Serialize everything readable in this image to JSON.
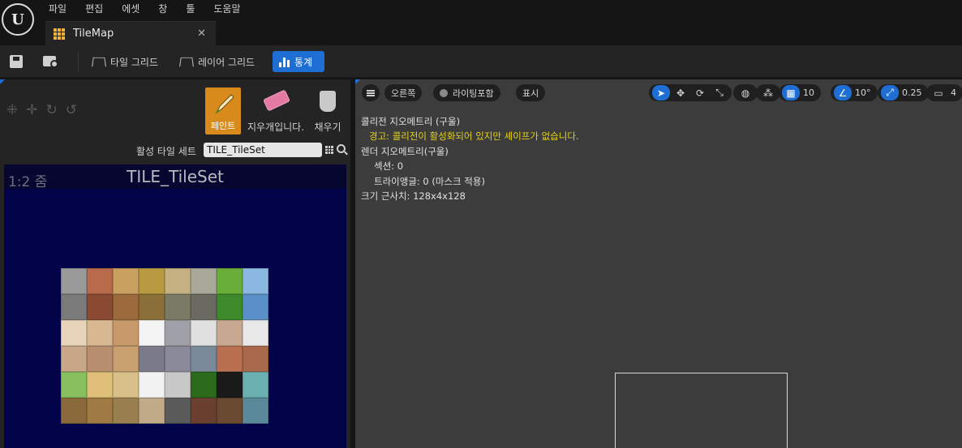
{
  "app": {
    "logo_text": "U",
    "menu": [
      "파일",
      "편집",
      "에셋",
      "창",
      "툴",
      "도움말"
    ]
  },
  "tab": {
    "title": "TileMap",
    "close": "✕"
  },
  "toolbar": {
    "tile_grid": "타일 그리드",
    "layer_grid": "레이어 그리드",
    "stats": "통계"
  },
  "tools": {
    "paint": "페인트",
    "erase": "지우개입니다.",
    "fill": "채우기"
  },
  "tileset": {
    "active_label": "활성 타일 세트",
    "active_value": "TILE_TileSet",
    "zoom": "1:2 줌",
    "title": "TILE_TileSet"
  },
  "viewport": {
    "perspective": "오른쪽",
    "lighting": "라이팅포함",
    "show": "표시",
    "grid_snap": "10",
    "rot_snap": "10°",
    "scale_snap": "0.25",
    "camera_speed": "4"
  },
  "stats": {
    "collision_geometry": "콜리전 지오메트리 (구울)",
    "warning": "경고: 콜리전이 활성화되어 있지만 셰이프가 없습니다.",
    "render_geometry": "렌더 지오메트리(구울)",
    "sections": "섹션: 0",
    "triangles": "트라이앵글: 0 (마스크 적용)",
    "approx_size": "크기 근사치: 128x4x128"
  },
  "colors": {
    "accent": "#1f6ed3",
    "paint_active": "#d88a1a",
    "warning": "#e4d21a",
    "tileview_bg": "#03034a"
  },
  "tile_colors": [
    "#9a9a9a",
    "#b86a4a",
    "#c8a060",
    "#b89a40",
    "#c4b080",
    "#a8a898",
    "#6aae3a",
    "#8ab8e0",
    "#7a7a7a",
    "#8a4a32",
    "#9a6a3a",
    "#8a7038",
    "#7a7a66",
    "#6a6a60",
    "#3e8a2a",
    "#5a90c8",
    "#e8d4b8",
    "#d8b890",
    "#c89a6a",
    "#f4f4f4",
    "#a0a0a8",
    "#e0e0e0",
    "#c8a890",
    "#e8e8e8",
    "#c8a888",
    "#b89070",
    "#c8a070",
    "#7a7a8a",
    "#8a8a9a",
    "#7a8a9a",
    "#b87050",
    "#a86a4a",
    "#88c060",
    "#e0c078",
    "#d8c088",
    "#f2f2f2",
    "#c8c8c8",
    "#2a6a1a",
    "#1a1a1a",
    "#6ab0b0",
    "#8a6a3a",
    "#a07a44",
    "#9a8050",
    "#c0aa88",
    "#5a5a5a",
    "#6a4030",
    "#6a4a30",
    "#5a8a9a"
  ]
}
